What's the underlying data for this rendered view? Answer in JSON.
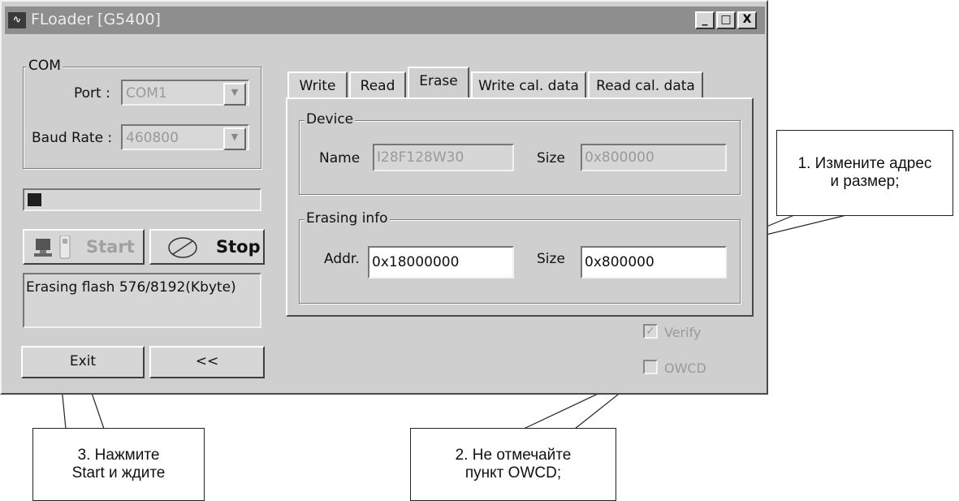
{
  "window": {
    "title": "FLoader [G5400]",
    "app_icon_glyph": "∿",
    "minimize_label": "_",
    "maximize_label": "□",
    "close_label": "X"
  },
  "com": {
    "legend": "COM",
    "port_label": "Port :",
    "port_value": "COM1",
    "baud_label": "Baud Rate :",
    "baud_value": "460800"
  },
  "progress": {
    "fraction": 0.06
  },
  "buttons": {
    "start_label": "Start",
    "stop_label": "Stop",
    "exit_label": "Exit",
    "back_label": "<<"
  },
  "status": {
    "text": "Erasing flash 576/8192(Kbyte)"
  },
  "tabs": [
    {
      "label": "Write",
      "active": false
    },
    {
      "label": "Read",
      "active": false
    },
    {
      "label": "Erase",
      "active": true
    },
    {
      "label": "Write cal. data",
      "active": false
    },
    {
      "label": "Read cal. data",
      "active": false
    }
  ],
  "device": {
    "legend": "Device",
    "name_label": "Name",
    "name_value": "I28F128W30",
    "size_label": "Size",
    "size_value": "0x800000"
  },
  "erasing": {
    "legend": "Erasing info",
    "addr_label": "Addr.",
    "addr_value": "0x18000000",
    "size_label": "Size",
    "size_value": "0x800000"
  },
  "options": {
    "verify_label": "Verify",
    "verify_checked": true,
    "owcd_label": "OWCD",
    "owcd_checked": false
  },
  "callouts": {
    "one": [
      "1. Измените адрес",
      "и размер;"
    ],
    "two": [
      "2. Не отмечайте",
      "пункт OWCD;"
    ],
    "three": [
      "3. Нажмите",
      "Start и ждите"
    ]
  },
  "colors": {
    "window_bg": "#cfcfcf",
    "titlebar": "#8e8e8e",
    "progress_fill": "#1e1e1e"
  }
}
